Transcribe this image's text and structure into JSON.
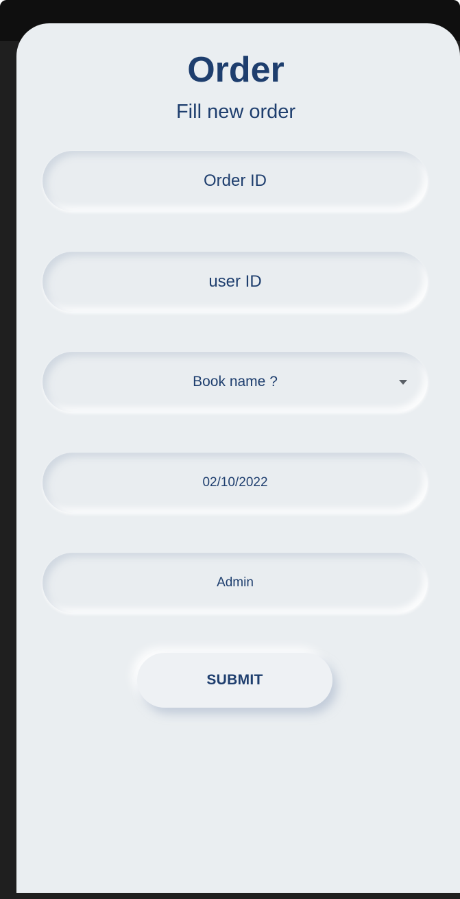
{
  "header": {
    "title": "Order",
    "subtitle": "Fill new order"
  },
  "form": {
    "order_id_placeholder": "Order ID",
    "user_id_placeholder": "user ID",
    "book_name_placeholder": "Book name ?",
    "date_value": "02/10/2022",
    "role_value": "Admin",
    "submit_label": "SUBMIT"
  },
  "colors": {
    "accent": "#1e3e6e",
    "background": "#eaeef1"
  },
  "icons": {
    "dropdown": "chevron-down-icon"
  }
}
